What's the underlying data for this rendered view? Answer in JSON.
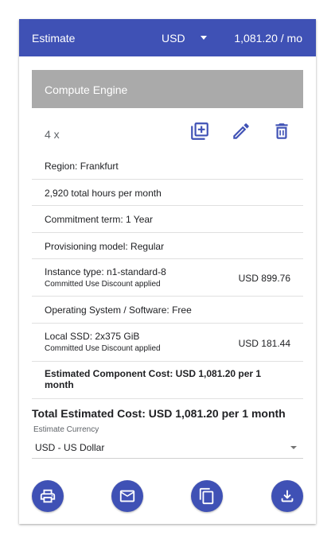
{
  "header": {
    "title": "Estimate",
    "currency": "USD",
    "total": "1,081.20 / mo"
  },
  "component": {
    "name": "Compute Engine",
    "quantity": "4 x",
    "rows": {
      "region": "Region: Frankfurt",
      "hours": "2,920 total hours per month",
      "commitment": "Commitment term: 1 Year",
      "provisioning": "Provisioning model: Regular",
      "instance": "Instance type: n1-standard-8",
      "instance_discount": "Committed Use Discount applied",
      "instance_price": "USD 899.76",
      "os": "Operating System / Software: Free",
      "ssd": "Local SSD: 2x375 GiB",
      "ssd_discount": "Committed Use Discount applied",
      "ssd_price": "USD 181.44",
      "component_cost": "Estimated Component Cost: USD 1,081.20 per 1 month"
    }
  },
  "total_estimated": "Total Estimated Cost: USD 1,081.20 per 1 month",
  "currency_select": {
    "label": "Estimate Currency",
    "value": "USD - US Dollar"
  },
  "icons": {
    "duplicate": "add-copy-icon",
    "edit": "pencil-icon",
    "delete": "trash-icon",
    "print": "printer-icon",
    "email": "envelope-icon",
    "copy": "copy-icon",
    "download": "download-icon"
  },
  "colors": {
    "primary": "#3f51b5",
    "component_bar": "#aaaaaa"
  }
}
